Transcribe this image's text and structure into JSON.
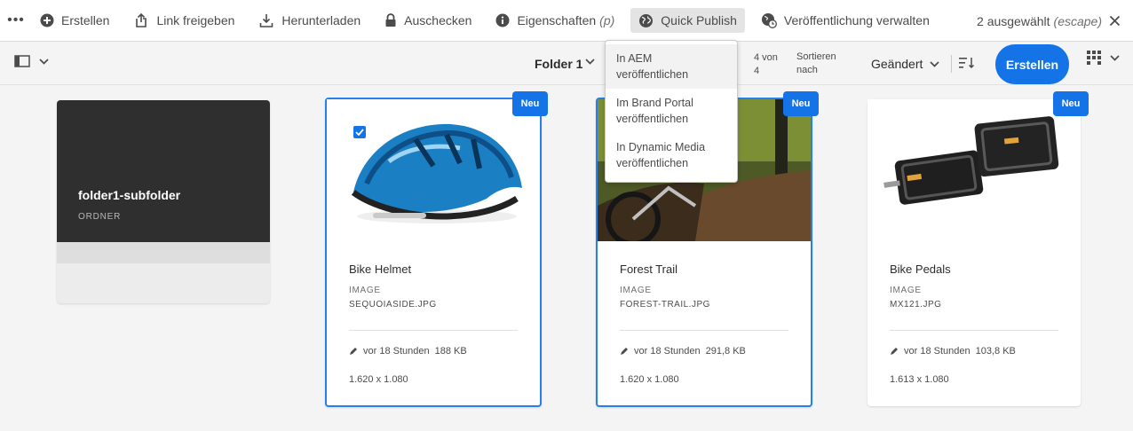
{
  "actionbar": {
    "more_label": "•••",
    "actions": [
      {
        "label": "Erstellen",
        "icon": "add-circle-icon"
      },
      {
        "label": "Link freigeben",
        "icon": "share-icon"
      },
      {
        "label": "Herunterladen",
        "icon": "download-icon"
      },
      {
        "label": "Auschecken",
        "icon": "lock-icon"
      },
      {
        "label": "Eigenschaften",
        "hint": "(p)",
        "icon": "info-icon"
      },
      {
        "label": "Quick Publish",
        "icon": "globe-icon"
      },
      {
        "label": "Veröffentlichung verwalten",
        "icon": "globe-clock-icon"
      }
    ],
    "selection_count": "2 ausgewählt",
    "selection_hint": "(escape)"
  },
  "toolbar": {
    "folder": "Folder 1",
    "counter": "4 von 4",
    "sort_label": "Sortieren nach",
    "sort_value": "Geändert",
    "create_label": "Erstellen"
  },
  "quick_publish_menu": {
    "items": [
      "In AEM veröffentlichen",
      "Im Brand Portal veröffentlichen",
      "In Dynamic Media veröffentlichen"
    ]
  },
  "folder_card": {
    "title": "folder1-subfolder",
    "type": "ORDNER"
  },
  "assets": [
    {
      "badge": "Neu",
      "title": "Bike Helmet",
      "type": "IMAGE",
      "file": "SEQUOIASIDE.JPG",
      "modified": "vor 18 Stunden",
      "size": "188 KB",
      "dims": "1.620 x 1.080",
      "selected": true
    },
    {
      "badge": "Neu",
      "title": "Forest Trail",
      "type": "IMAGE",
      "file": "FOREST-TRAIL.JPG",
      "modified": "vor 18 Stunden",
      "size": "291,8 KB",
      "dims": "1.620 x 1.080",
      "selected": true
    },
    {
      "badge": "Neu",
      "title": "Bike Pedals",
      "type": "IMAGE",
      "file": "MX121.JPG",
      "modified": "vor 18 Stunden",
      "size": "103,8 KB",
      "dims": "1.613 x 1.080",
      "selected": false
    }
  ],
  "colors": {
    "accent": "#1473e6",
    "selection_border": "#2680eb",
    "folder_bg": "#2f2f2f"
  }
}
